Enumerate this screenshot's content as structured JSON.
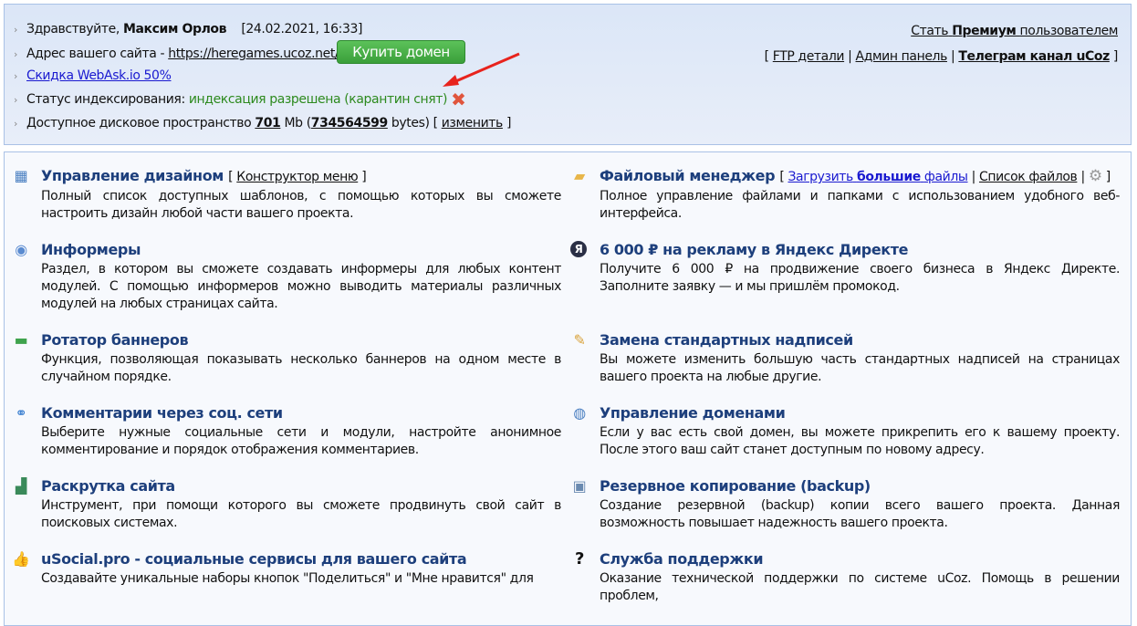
{
  "header": {
    "greeting": "Здравствуйте,",
    "user": "Максим Орлов",
    "datetime": "[24.02.2021, 16:33]",
    "address_label": "Адрес вашего сайта -",
    "address": "https://heregames.ucoz.net/",
    "buy_domain": "Купить домен",
    "discount": "Скидка WebAsk.io 50%",
    "index_label": "Статус индексирования:",
    "index_status": "индексация разрешена (карантин снят)",
    "disk_label": "Доступное дисковое пространство",
    "disk_mb": "701",
    "mb": "Mb",
    "disk_bytes": "734564599",
    "bytes": "bytes",
    "change": "изменить",
    "premium_pre": "Стать",
    "premium_bold": "Премиум",
    "premium_post": "пользователем",
    "ftp": "FTP детали",
    "admin": "Админ панель",
    "telegram": "Телеграм канал uCoz"
  },
  "sections": [
    {
      "title": "Управление дизайном",
      "ext": "Конструктор меню",
      "desc": "Полный список доступных шаблонов, с помощью которых вы сможете настроить дизайн любой части вашего проекта."
    },
    {
      "title": "Файловый менеджер",
      "ext_link_pre": "Загрузить",
      "ext_link_bold": "большие",
      "ext_link_post": "файлы",
      "ext2": "Список файлов",
      "desc": "Полное управление файлами и папками с использованием удобного веб-интерфейса."
    },
    {
      "title": "Информеры",
      "desc": "Раздел, в котором вы сможете создавать информеры для любых контент модулей. С помощью информеров можно выводить материалы различных модулей на любых страницах сайта."
    },
    {
      "title": "6 000 ₽ на рекламу в Яндекс Директе",
      "desc": "Получите 6 000 ₽ на продвижение своего бизнеса в Яндекс Директе. Заполните заявку — и мы пришлём промокод."
    },
    {
      "title": "Ротатор баннеров",
      "desc": "Функция, позволяющая показывать несколько баннеров на одном месте в случайном порядке."
    },
    {
      "title": "Замена стандартных надписей",
      "desc": "Вы можете изменить большую часть стандартных надписей на страницах вашего проекта на любые другие."
    },
    {
      "title": "Комментарии через соц. сети",
      "desc": "Выберите нужные социальные сети и модули, настройте анонимное комментирование и порядок отображения комментариев."
    },
    {
      "title": "Управление доменами",
      "desc": "Если у вас есть свой домен, вы можете прикрепить его к вашему проекту. После этого ваш сайт станет доступным по новому адресу."
    },
    {
      "title": "Раскрутка сайта",
      "desc": "Инструмент, при помощи которого вы сможете продвинуть свой сайт в поисковых системах."
    },
    {
      "title": "Резервное копирование (backup)",
      "desc": "Создание резервной (backup) копии всего вашего проекта. Данная возможность повышает надежность вашего проекта."
    },
    {
      "title": "uSocial.pro - социальные сервисы для вашего сайта",
      "desc": "Создавайте уникальные наборы кнопок \"Поделиться\" и \"Мне нравится\" для"
    },
    {
      "title": "Служба поддержки",
      "desc": "Оказание технической поддержки по системе uCoz. Помощь в решении проблем,"
    }
  ]
}
